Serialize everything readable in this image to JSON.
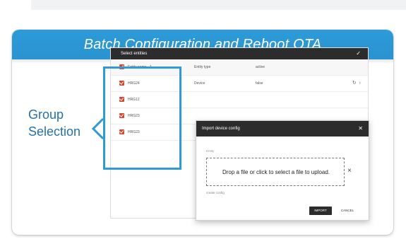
{
  "header": {
    "title": "Batch Configuration and Reboot OTA"
  },
  "callout": {
    "line1": "Group",
    "line2": "Selection"
  },
  "entities_panel": {
    "title": "Select entities",
    "columns": {
      "name": "Entity name",
      "type": "Entity type",
      "active": "active"
    },
    "rows": [
      {
        "name": "HRG24",
        "type": "Device",
        "active": "false"
      },
      {
        "name": "HRG12",
        "type": "",
        "active": ""
      },
      {
        "name": "HRG23",
        "type": "",
        "active": ""
      },
      {
        "name": "HRG23",
        "type": "",
        "active": ""
      }
    ]
  },
  "dialog": {
    "title": "Import device config",
    "field_label": "Entity",
    "dropzone_text": "Drop a file or click to select a file to upload.",
    "create_config_label": "create config",
    "import_button": "IMPORT",
    "cancel_button": "CANCEL"
  },
  "colors": {
    "accent": "#2d9bd8",
    "callout_text": "#2472ac",
    "checkbox": "#d9472b",
    "titlebar": "#2c2c2c"
  },
  "icons": {
    "sort": "arrow-up-icon",
    "confirm": "check-icon",
    "close": "close-icon",
    "refresh": "refresh-icon",
    "expand": "chevron-icon"
  }
}
